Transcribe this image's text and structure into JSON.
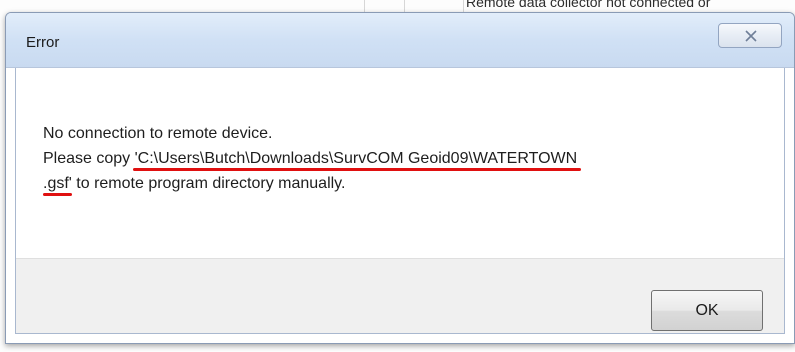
{
  "background": {
    "status_text": "Remote data collector not connected or"
  },
  "dialog": {
    "title": "Error",
    "message_line1": "No connection to remote device.",
    "message_line2_prefix": " Please copy ",
    "message_line2_path": "'C:\\Users\\Butch\\Downloads\\SurvCOM Geoid09\\WATERTOWN",
    "message_line3_ext": ".gsf'",
    "message_line3_suffix": " to remote program directory manually.",
    "ok_label": "OK",
    "close_icon": "close-x-icon"
  },
  "colors": {
    "highlight_underline": "#e01010",
    "titlebar": "#cfdff3"
  }
}
